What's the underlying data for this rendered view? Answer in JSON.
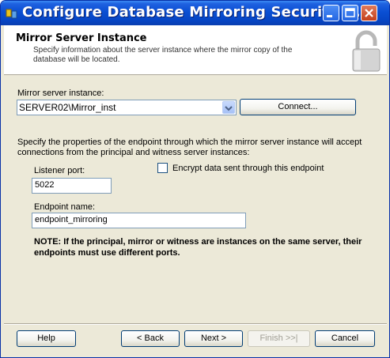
{
  "window": {
    "title": "Configure Database Mirroring Security ...",
    "controls": [
      "minimize-icon",
      "maximize-icon",
      "close-icon"
    ]
  },
  "header": {
    "title": "Mirror Server Instance",
    "description": "Specify information about the server instance where the mirror copy of the database will be located.",
    "icon": "padlock-icon"
  },
  "form": {
    "mirror_label": "Mirror server instance:",
    "mirror_value": "SERVER02\\Mirror_inst",
    "connect_label": "Connect...",
    "endpoint_desc": "Specify the properties of the endpoint through which the mirror server instance will accept connections from the principal and witness server instances:",
    "listener_label": "Listener port:",
    "listener_value": "5022",
    "encrypt_label": "Encrypt data sent through this endpoint",
    "encrypt_checked": false,
    "endpoint_label": "Endpoint name:",
    "endpoint_value": "endpoint_mirroring",
    "note": "NOTE: If the principal, mirror or witness are instances on the same server, their endpoints must use different ports."
  },
  "footer": {
    "help": "Help",
    "back": "< Back",
    "next": "Next >",
    "finish": "Finish >>|",
    "cancel": "Cancel"
  },
  "colors": {
    "titlebar": "#0a4fd3",
    "face": "#ece9d8",
    "button_border": "#003c74"
  }
}
